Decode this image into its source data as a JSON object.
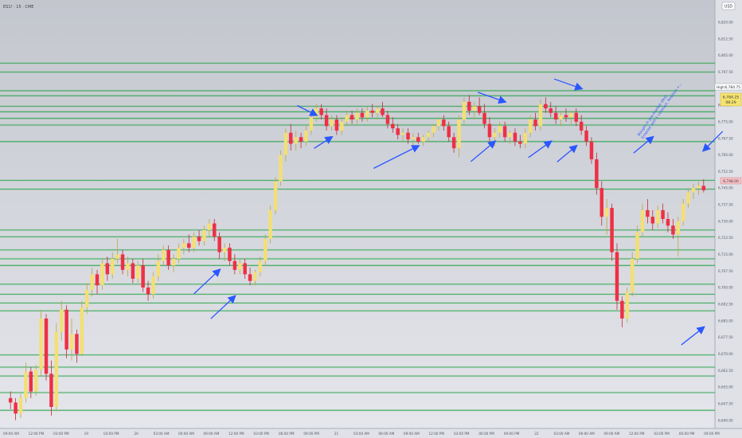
{
  "header": {
    "symbol": "ES1! · 15 · CME",
    "currency": "USD"
  },
  "colors": {
    "up": "#f3df74",
    "down": "#ef2f45",
    "level": "#2da44e",
    "arrow": "#2a57ff",
    "annotation": "#2a57ff",
    "background_top": "#c3c6ce",
    "background_bottom": "#e6e7ec"
  },
  "price_tags": {
    "high_label": "High",
    "high_value": "6,784.75",
    "last_value": "6,784.25",
    "countdown": "08:29",
    "level_value": "6,748.00"
  },
  "annotation_text": [
    "Bought in pre-market (first",
    "Entered with 1 contract. Position +..."
  ],
  "chart_data": {
    "type": "candlestick",
    "y_axis": {
      "min": 6637,
      "max": 6825,
      "tick_step": 3.75,
      "tick_labels_shown_every": 2
    },
    "x_tick_labels": [
      "09:00 AM",
      "12:00 PM",
      "03:00 PM",
      "19",
      "03:00 PM",
      "20",
      "03:00 AM",
      "06:00 AM",
      "09:00 AM",
      "12:00 PM",
      "03:00 PM",
      "06:00 PM",
      "09:00 PM",
      "21",
      "03:00 AM",
      "06:00 AM",
      "09:00 AM",
      "12:00 PM",
      "03:00 PM",
      "06:00 PM",
      "09:00 PM",
      "22",
      "03:00 AM",
      "06:00 AM",
      "09:00 AM",
      "12:00 PM",
      "03:00 PM",
      "06:00 PM",
      "09:00 PM"
    ],
    "horizontal_levels": [
      6644.5,
      6652.5,
      6660,
      6664,
      6669.5,
      6689.5,
      6693,
      6697,
      6701.5,
      6710,
      6713,
      6717,
      6723,
      6726,
      6744.5,
      6748.5,
      6766,
      6773.5,
      6776.5,
      6779.5,
      6782,
      6786.75,
      6789,
      6797.5,
      6801.5
    ],
    "candles": [
      {
        "o": 6650,
        "h": 6653,
        "l": 6645,
        "c": 6648
      },
      {
        "o": 6648,
        "h": 6650,
        "l": 6640,
        "c": 6643
      },
      {
        "o": 6643,
        "h": 6652,
        "l": 6641,
        "c": 6650
      },
      {
        "o": 6650,
        "h": 6666,
        "l": 6648,
        "c": 6662
      },
      {
        "o": 6662,
        "h": 6664,
        "l": 6650,
        "c": 6653
      },
      {
        "o": 6653,
        "h": 6665,
        "l": 6651,
        "c": 6663
      },
      {
        "o": 6663,
        "h": 6690,
        "l": 6660,
        "c": 6686
      },
      {
        "o": 6686,
        "h": 6688,
        "l": 6658,
        "c": 6661
      },
      {
        "o": 6661,
        "h": 6667,
        "l": 6642,
        "c": 6646
      },
      {
        "o": 6646,
        "h": 6684,
        "l": 6644,
        "c": 6680
      },
      {
        "o": 6680,
        "h": 6694,
        "l": 6676,
        "c": 6690
      },
      {
        "o": 6690,
        "h": 6692,
        "l": 6668,
        "c": 6672
      },
      {
        "o": 6672,
        "h": 6686,
        "l": 6667,
        "c": 6679
      },
      {
        "o": 6679,
        "h": 6681,
        "l": 6666,
        "c": 6670
      },
      {
        "o": 6670,
        "h": 6694,
        "l": 6669,
        "c": 6691
      },
      {
        "o": 6691,
        "h": 6702,
        "l": 6688,
        "c": 6699
      },
      {
        "o": 6699,
        "h": 6709,
        "l": 6696,
        "c": 6706
      },
      {
        "o": 6706,
        "h": 6708,
        "l": 6697,
        "c": 6701
      },
      {
        "o": 6701,
        "h": 6713,
        "l": 6699,
        "c": 6711
      },
      {
        "o": 6711,
        "h": 6714,
        "l": 6703,
        "c": 6706
      },
      {
        "o": 6706,
        "h": 6716,
        "l": 6704,
        "c": 6713
      },
      {
        "o": 6713,
        "h": 6722,
        "l": 6711,
        "c": 6715
      },
      {
        "o": 6715,
        "h": 6717,
        "l": 6706,
        "c": 6708
      },
      {
        "o": 6708,
        "h": 6714,
        "l": 6705,
        "c": 6711
      },
      {
        "o": 6711,
        "h": 6713,
        "l": 6702,
        "c": 6704
      },
      {
        "o": 6704,
        "h": 6712,
        "l": 6702,
        "c": 6710
      },
      {
        "o": 6710,
        "h": 6713,
        "l": 6698,
        "c": 6700
      },
      {
        "o": 6700,
        "h": 6703,
        "l": 6694,
        "c": 6697
      },
      {
        "o": 6697,
        "h": 6707,
        "l": 6695,
        "c": 6705
      },
      {
        "o": 6705,
        "h": 6715,
        "l": 6703,
        "c": 6712
      },
      {
        "o": 6712,
        "h": 6719,
        "l": 6710,
        "c": 6717
      },
      {
        "o": 6717,
        "h": 6719,
        "l": 6708,
        "c": 6710
      },
      {
        "o": 6710,
        "h": 6715,
        "l": 6707,
        "c": 6713
      },
      {
        "o": 6713,
        "h": 6720,
        "l": 6711,
        "c": 6718
      },
      {
        "o": 6718,
        "h": 6722,
        "l": 6715,
        "c": 6720
      },
      {
        "o": 6720,
        "h": 6724,
        "l": 6716,
        "c": 6718
      },
      {
        "o": 6718,
        "h": 6725,
        "l": 6716,
        "c": 6723
      },
      {
        "o": 6723,
        "h": 6726,
        "l": 6719,
        "c": 6721
      },
      {
        "o": 6721,
        "h": 6728,
        "l": 6719,
        "c": 6726
      },
      {
        "o": 6726,
        "h": 6731,
        "l": 6723,
        "c": 6729
      },
      {
        "o": 6729,
        "h": 6731,
        "l": 6721,
        "c": 6723
      },
      {
        "o": 6723,
        "h": 6725,
        "l": 6713,
        "c": 6716
      },
      {
        "o": 6716,
        "h": 6720,
        "l": 6712,
        "c": 6718
      },
      {
        "o": 6718,
        "h": 6720,
        "l": 6710,
        "c": 6712
      },
      {
        "o": 6712,
        "h": 6715,
        "l": 6706,
        "c": 6708
      },
      {
        "o": 6708,
        "h": 6713,
        "l": 6706,
        "c": 6711
      },
      {
        "o": 6711,
        "h": 6713,
        "l": 6704,
        "c": 6706
      },
      {
        "o": 6706,
        "h": 6709,
        "l": 6701,
        "c": 6703
      },
      {
        "o": 6703,
        "h": 6708,
        "l": 6701,
        "c": 6707
      },
      {
        "o": 6707,
        "h": 6714,
        "l": 6705,
        "c": 6712
      },
      {
        "o": 6712,
        "h": 6724,
        "l": 6710,
        "c": 6722
      },
      {
        "o": 6722,
        "h": 6737,
        "l": 6720,
        "c": 6735
      },
      {
        "o": 6735,
        "h": 6750,
        "l": 6733,
        "c": 6748
      },
      {
        "o": 6748,
        "h": 6762,
        "l": 6746,
        "c": 6760
      },
      {
        "o": 6760,
        "h": 6772,
        "l": 6757,
        "c": 6770
      },
      {
        "o": 6770,
        "h": 6774,
        "l": 6762,
        "c": 6765
      },
      {
        "o": 6765,
        "h": 6771,
        "l": 6762,
        "c": 6768
      },
      {
        "o": 6768,
        "h": 6770,
        "l": 6763,
        "c": 6766
      },
      {
        "o": 6766,
        "h": 6773,
        "l": 6764,
        "c": 6771
      },
      {
        "o": 6771,
        "h": 6779,
        "l": 6769,
        "c": 6777
      },
      {
        "o": 6777,
        "h": 6783,
        "l": 6775,
        "c": 6781
      },
      {
        "o": 6781,
        "h": 6783,
        "l": 6776,
        "c": 6778
      },
      {
        "o": 6778,
        "h": 6781,
        "l": 6771,
        "c": 6773
      },
      {
        "o": 6773,
        "h": 6778,
        "l": 6771,
        "c": 6776
      },
      {
        "o": 6776,
        "h": 6778,
        "l": 6769,
        "c": 6771
      },
      {
        "o": 6771,
        "h": 6777,
        "l": 6769,
        "c": 6775
      },
      {
        "o": 6775,
        "h": 6780,
        "l": 6773,
        "c": 6778
      },
      {
        "o": 6778,
        "h": 6780,
        "l": 6774,
        "c": 6776
      },
      {
        "o": 6776,
        "h": 6781,
        "l": 6774,
        "c": 6779
      },
      {
        "o": 6779,
        "h": 6781,
        "l": 6775,
        "c": 6777
      },
      {
        "o": 6777,
        "h": 6782,
        "l": 6775,
        "c": 6780
      },
      {
        "o": 6780,
        "h": 6783,
        "l": 6777,
        "c": 6779
      },
      {
        "o": 6779,
        "h": 6782,
        "l": 6776,
        "c": 6781
      },
      {
        "o": 6781,
        "h": 6784,
        "l": 6777,
        "c": 6778
      },
      {
        "o": 6778,
        "h": 6780,
        "l": 6772,
        "c": 6774
      },
      {
        "o": 6774,
        "h": 6777,
        "l": 6770,
        "c": 6772
      },
      {
        "o": 6772,
        "h": 6774,
        "l": 6767,
        "c": 6769
      },
      {
        "o": 6769,
        "h": 6772,
        "l": 6766,
        "c": 6770
      },
      {
        "o": 6770,
        "h": 6772,
        "l": 6765,
        "c": 6767
      },
      {
        "o": 6767,
        "h": 6770,
        "l": 6764,
        "c": 6768
      },
      {
        "o": 6768,
        "h": 6770,
        "l": 6765,
        "c": 6766
      },
      {
        "o": 6766,
        "h": 6769,
        "l": 6764,
        "c": 6768
      },
      {
        "o": 6768,
        "h": 6771,
        "l": 6766,
        "c": 6770
      },
      {
        "o": 6770,
        "h": 6774,
        "l": 6768,
        "c": 6773
      },
      {
        "o": 6773,
        "h": 6777,
        "l": 6771,
        "c": 6776
      },
      {
        "o": 6776,
        "h": 6778,
        "l": 6771,
        "c": 6773
      },
      {
        "o": 6773,
        "h": 6775,
        "l": 6766,
        "c": 6768
      },
      {
        "o": 6768,
        "h": 6770,
        "l": 6761,
        "c": 6763
      },
      {
        "o": 6763,
        "h": 6778,
        "l": 6759,
        "c": 6776
      },
      {
        "o": 6776,
        "h": 6786,
        "l": 6774,
        "c": 6784
      },
      {
        "o": 6784,
        "h": 6787,
        "l": 6778,
        "c": 6780
      },
      {
        "o": 6780,
        "h": 6784,
        "l": 6776,
        "c": 6782
      },
      {
        "o": 6782,
        "h": 6786,
        "l": 6778,
        "c": 6779
      },
      {
        "o": 6779,
        "h": 6783,
        "l": 6772,
        "c": 6774
      },
      {
        "o": 6774,
        "h": 6777,
        "l": 6766,
        "c": 6768
      },
      {
        "o": 6768,
        "h": 6772,
        "l": 6764,
        "c": 6770
      },
      {
        "o": 6770,
        "h": 6775,
        "l": 6768,
        "c": 6773
      },
      {
        "o": 6773,
        "h": 6775,
        "l": 6766,
        "c": 6768
      },
      {
        "o": 6768,
        "h": 6771,
        "l": 6765,
        "c": 6770
      },
      {
        "o": 6770,
        "h": 6772,
        "l": 6764,
        "c": 6766
      },
      {
        "o": 6766,
        "h": 6769,
        "l": 6763,
        "c": 6765
      },
      {
        "o": 6765,
        "h": 6772,
        "l": 6763,
        "c": 6770
      },
      {
        "o": 6770,
        "h": 6778,
        "l": 6768,
        "c": 6776
      },
      {
        "o": 6776,
        "h": 6779,
        "l": 6771,
        "c": 6773
      },
      {
        "o": 6773,
        "h": 6785,
        "l": 6771,
        "c": 6783
      },
      {
        "o": 6783,
        "h": 6786,
        "l": 6779,
        "c": 6781
      },
      {
        "o": 6781,
        "h": 6784,
        "l": 6777,
        "c": 6779
      },
      {
        "o": 6779,
        "h": 6782,
        "l": 6774,
        "c": 6776
      },
      {
        "o": 6776,
        "h": 6780,
        "l": 6773,
        "c": 6778
      },
      {
        "o": 6778,
        "h": 6781,
        "l": 6775,
        "c": 6777
      },
      {
        "o": 6777,
        "h": 6780,
        "l": 6774,
        "c": 6779
      },
      {
        "o": 6779,
        "h": 6781,
        "l": 6773,
        "c": 6775
      },
      {
        "o": 6775,
        "h": 6778,
        "l": 6769,
        "c": 6771
      },
      {
        "o": 6771,
        "h": 6773,
        "l": 6764,
        "c": 6766
      },
      {
        "o": 6766,
        "h": 6768,
        "l": 6756,
        "c": 6758
      },
      {
        "o": 6758,
        "h": 6761,
        "l": 6742,
        "c": 6745
      },
      {
        "o": 6745,
        "h": 6748,
        "l": 6728,
        "c": 6732
      },
      {
        "o": 6732,
        "h": 6740,
        "l": 6724,
        "c": 6736
      },
      {
        "o": 6736,
        "h": 6738,
        "l": 6712,
        "c": 6716
      },
      {
        "o": 6716,
        "h": 6720,
        "l": 6690,
        "c": 6694
      },
      {
        "o": 6694,
        "h": 6696,
        "l": 6682,
        "c": 6686
      },
      {
        "o": 6686,
        "h": 6700,
        "l": 6684,
        "c": 6698
      },
      {
        "o": 6698,
        "h": 6716,
        "l": 6696,
        "c": 6713
      },
      {
        "o": 6713,
        "h": 6728,
        "l": 6711,
        "c": 6725
      },
      {
        "o": 6725,
        "h": 6738,
        "l": 6723,
        "c": 6735
      },
      {
        "o": 6735,
        "h": 6740,
        "l": 6729,
        "c": 6732
      },
      {
        "o": 6732,
        "h": 6735,
        "l": 6726,
        "c": 6729
      },
      {
        "o": 6729,
        "h": 6737,
        "l": 6727,
        "c": 6735
      },
      {
        "o": 6735,
        "h": 6738,
        "l": 6729,
        "c": 6731
      },
      {
        "o": 6731,
        "h": 6734,
        "l": 6725,
        "c": 6728
      },
      {
        "o": 6728,
        "h": 6731,
        "l": 6722,
        "c": 6724
      },
      {
        "o": 6724,
        "h": 6732,
        "l": 6714,
        "c": 6730
      },
      {
        "o": 6730,
        "h": 6740,
        "l": 6728,
        "c": 6738
      },
      {
        "o": 6738,
        "h": 6745,
        "l": 6736,
        "c": 6743
      },
      {
        "o": 6743,
        "h": 6747,
        "l": 6740,
        "c": 6745
      },
      {
        "o": 6745,
        "h": 6748,
        "l": 6742,
        "c": 6746
      },
      {
        "o": 6746,
        "h": 6749,
        "l": 6743,
        "c": 6744
      }
    ]
  }
}
